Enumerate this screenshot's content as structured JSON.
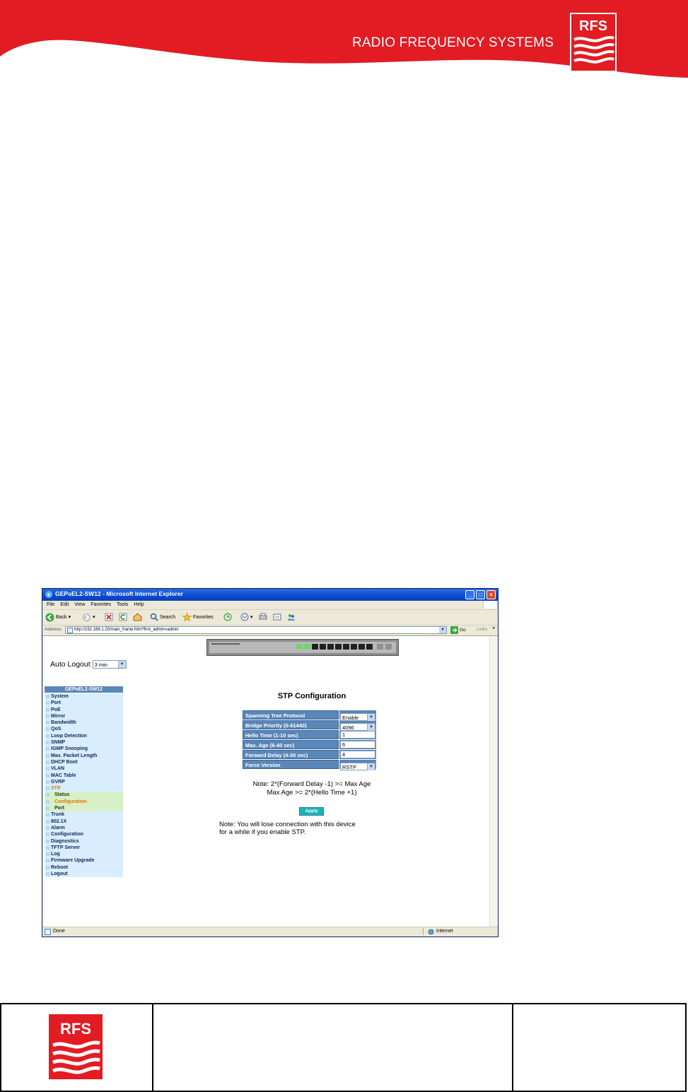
{
  "doc": {
    "brand": "RADIO FREQUENCY SYSTEMS",
    "logo_text": "RFS",
    "brand_color": "#e31b23"
  },
  "browser": {
    "window_title": "GEPoEL2-SW12 - Microsoft Internet Explorer",
    "menu": [
      "File",
      "Edit",
      "View",
      "Favorites",
      "Tools",
      "Help"
    ],
    "toolbar": {
      "back": "Back",
      "search": "Search",
      "favorites": "Favorites"
    },
    "address_label": "Address",
    "address_value": "http://192.168.1.20/main_frame.htm?first_admin=admin",
    "go_label": "Go",
    "links_label": "Links",
    "status_left": "Done",
    "status_zone": "Internet"
  },
  "page": {
    "auto_logout_label": "Auto Logout",
    "auto_logout_value": "3 min",
    "nav_header": "GEPoEL2-SW12",
    "nav": [
      {
        "label": "System"
      },
      {
        "label": "Port"
      },
      {
        "label": "PoE"
      },
      {
        "label": "Mirror"
      },
      {
        "label": "Bandwidth"
      },
      {
        "label": "QoS"
      },
      {
        "label": "Loop Detection"
      },
      {
        "label": "SNMP"
      },
      {
        "label": "IGMP Snooping"
      },
      {
        "label": "Max. Packet Length"
      },
      {
        "label": "DHCP Boot"
      },
      {
        "label": "VLAN"
      },
      {
        "label": "MAC Table"
      },
      {
        "label": "GVRP"
      },
      {
        "label": "STP"
      },
      {
        "label": "Status"
      },
      {
        "label": "Configuration"
      },
      {
        "label": "Port"
      },
      {
        "label": "Trunk"
      },
      {
        "label": "802.1X"
      },
      {
        "label": "Alarm"
      },
      {
        "label": "Configuration"
      },
      {
        "label": "Diagnostics"
      },
      {
        "label": "TFTP Server"
      },
      {
        "label": "Log"
      },
      {
        "label": "Firmware Upgrade"
      },
      {
        "label": "Reboot"
      },
      {
        "label": "Logout"
      }
    ],
    "title": "STP Configuration",
    "fields": [
      {
        "label": "Spanning Tree Protocol",
        "value": "Enable"
      },
      {
        "label": "Bridge Priority (0-61440)",
        "value": "4096"
      },
      {
        "label": "Hello Time (1-10 sec)",
        "value": "1"
      },
      {
        "label": "Max. Age (6-40 sec)",
        "value": "6"
      },
      {
        "label": "Forward Delay (4-30 sec)",
        "value": "4"
      },
      {
        "label": "Force Version",
        "value": "RSTP"
      }
    ],
    "note1_line1": "Note: 2*(Forward Delay -1) >= Max Age",
    "note1_line2": "Max Age >= 2*(Hello Time +1)",
    "apply_label": "Apply",
    "note2_line1": "Note: You will lose connection with this device",
    "note2_line2": "for a while if you enable STP."
  }
}
